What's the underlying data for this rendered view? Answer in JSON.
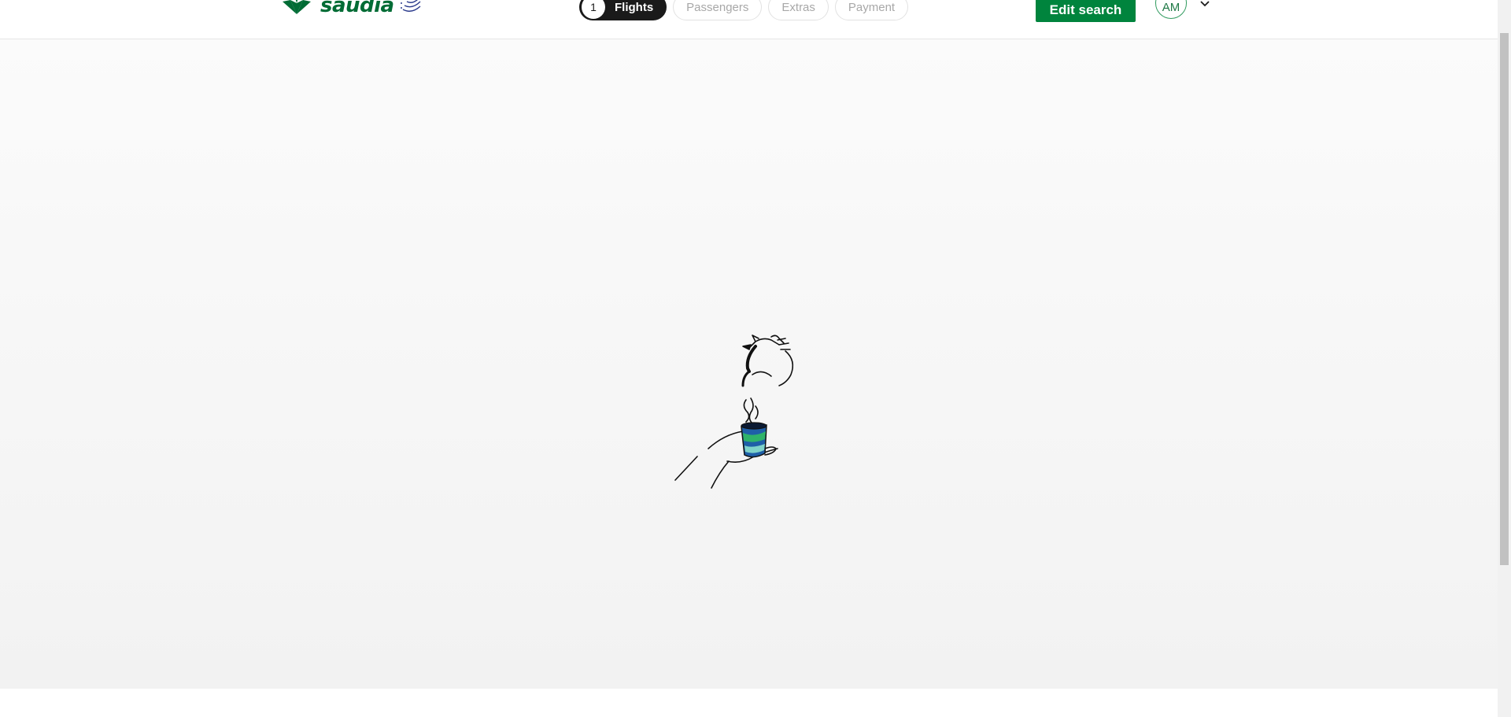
{
  "brand": {
    "name": "saudia",
    "color": "#006c35",
    "alliance_icon": "skyteam-icon"
  },
  "stepper": {
    "steps": [
      {
        "number": "1",
        "label": "Flights",
        "active": true
      },
      {
        "label": "Passengers",
        "active": false
      },
      {
        "label": "Extras",
        "active": false
      },
      {
        "label": "Payment",
        "active": false
      }
    ]
  },
  "header": {
    "edit_search_label": "Edit search",
    "edit_search_color": "#00843d",
    "avatar_initials": "AM",
    "account_menu_icon": "chevron-down-icon"
  },
  "loading": {
    "illustration": "coffee-pouring-loader-icon"
  }
}
